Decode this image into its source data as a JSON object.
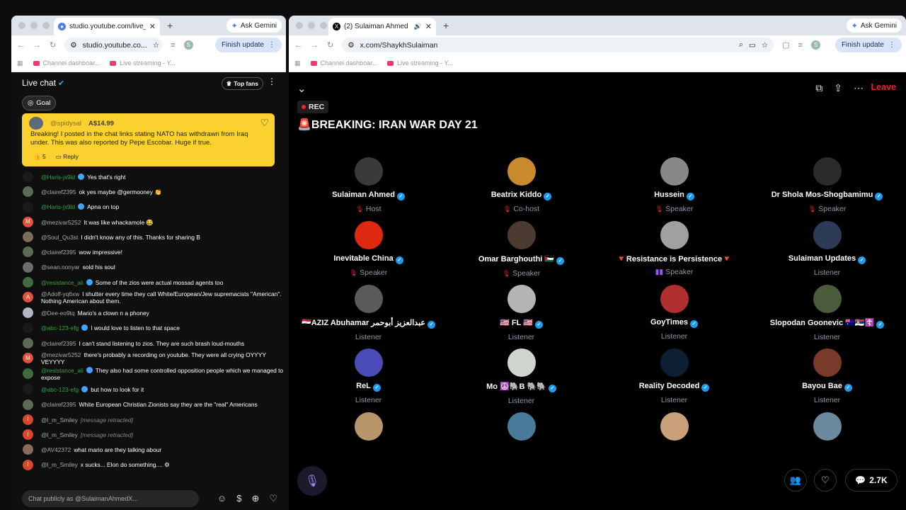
{
  "left_window": {
    "tab_title": "studio.youtube.com/live_chat",
    "url": "studio.youtube.co...",
    "ask_gemini": "Ask Gemini",
    "finish_update": "Finish update",
    "profile_initial": "S",
    "bookmarks": [
      "Channel dashboar...",
      "Live streaming - Y..."
    ]
  },
  "chat": {
    "title": "Live chat",
    "top_fans": "Top fans",
    "goal": "Goal",
    "superchat": {
      "user": "@spidysal",
      "amount": "A$14.99",
      "message": "Breaking! I posted in the chat links stating NATO has withdrawn from Iraq under. This was also reported by Pepe Escobar. Huge if true.",
      "likes": "5",
      "reply": "Reply"
    },
    "messages": [
      {
        "user": "@Haris-jx9ld",
        "text": "Yes that's right",
        "mod": true,
        "av": "#1a1a1a",
        "letter": ""
      },
      {
        "user": "@clairef2395",
        "text": "ok yes maybe @germooney 👏",
        "mod": false,
        "av": "#5b6b55",
        "letter": ""
      },
      {
        "user": "@Haris-jx9ld",
        "text": "Apna on top",
        "mod": true,
        "av": "#1a1a1a",
        "letter": ""
      },
      {
        "user": "@mezivar5252",
        "text": "It was like whackamole 😂",
        "mod": false,
        "av": "#e0533a",
        "letter": "M"
      },
      {
        "user": "@Soul_Qu3st",
        "text": "I didn't know any of this. Thanks for sharing B",
        "mod": false,
        "av": "#7a6e5a",
        "letter": ""
      },
      {
        "user": "@clairef2395",
        "text": "wow impressive!",
        "mod": false,
        "av": "#5b6b55",
        "letter": ""
      },
      {
        "user": "@sean.nonyar",
        "text": "sold his soul",
        "mod": false,
        "av": "#6d6d6d",
        "letter": ""
      },
      {
        "user": "@resistance_ali",
        "text": "Some of the zios were actual mossad agents too",
        "mod": true,
        "av": "#3f6b3f",
        "letter": ""
      },
      {
        "user": "@Adolf-yq6xw",
        "text": "I shutter every time they call White/European/Jew supremacists \"American\". Nothing American about them.",
        "mod": false,
        "av": "#e0533a",
        "letter": "A"
      },
      {
        "user": "@Dee-eo9tq",
        "text": "Mario's a clown n a phoney",
        "mod": false,
        "av": "#b0b8c4",
        "letter": ""
      },
      {
        "user": "@abc-123-efg",
        "text": "I would love to listen to that space",
        "mod": true,
        "av": "#1a1a1a",
        "letter": ""
      },
      {
        "user": "@clairef2395",
        "text": "I can't stand listening to zios. They are such brash loud-mouths",
        "mod": false,
        "av": "#5b6b55",
        "letter": ""
      },
      {
        "user": "@mezivar5252",
        "text": "there's probably a recording on youtube. They were all crying OYYYY VEYYYY",
        "mod": false,
        "av": "#e0533a",
        "letter": "M"
      },
      {
        "user": "@resistance_ali",
        "text": "They also had some controlled opposition people which we managed to expose",
        "mod": true,
        "av": "#3f6b3f",
        "letter": ""
      },
      {
        "user": "@abc-123-efg",
        "text": "but how to look for it",
        "mod": true,
        "av": "#1a1a1a",
        "letter": ""
      },
      {
        "user": "@clairef2395",
        "text": "White European Christian Zionists say they are the \"real\" Americans",
        "mod": false,
        "av": "#5b6b55",
        "letter": ""
      },
      {
        "user": "@l_m_Smiley",
        "text": "[message retracted]",
        "mod": false,
        "av": "#d9472b",
        "letter": "I",
        "retracted": true
      },
      {
        "user": "@l_m_Smiley",
        "text": "[message retracted]",
        "mod": false,
        "av": "#d9472b",
        "letter": "I",
        "retracted": true
      },
      {
        "user": "@AV42372",
        "text": "what mario are they talking abour",
        "mod": false,
        "av": "#8a6a5a",
        "letter": ""
      },
      {
        "user": "@l_m_Smiley",
        "text": "x sucks... Elon do something.... ⚙",
        "mod": false,
        "av": "#d9472b",
        "letter": "I"
      }
    ],
    "input_placeholder": "Chat publicly as @SulaimanAhmedX..."
  },
  "right_window": {
    "tab_title": "(2) Sulaiman Ahmed (@Sh",
    "url": "x.com/ShaykhSulaiman",
    "ask_gemini": "Ask Gemini",
    "finish_update": "Finish update",
    "profile_initial": "S",
    "bookmarks": [
      "Channel dashboar...",
      "Live streaming - Y..."
    ]
  },
  "space": {
    "rec": "REC",
    "title": "🚨BREAKING: IRAN WAR DAY 21",
    "leave": "Leave",
    "participants": [
      {
        "name": "Sulaiman Ahmed",
        "role": "Host",
        "icon": "red",
        "verified": true,
        "av": "#3a3a3a"
      },
      {
        "name": "Beatrix Kiddo",
        "role": "Co-host",
        "icon": "red",
        "verified": true,
        "av": "#c98a2e"
      },
      {
        "name": "Hussein",
        "role": "Speaker",
        "icon": "red",
        "verified": true,
        "av": "#888888"
      },
      {
        "name": "Dr Shola Mos-Shogbamimu",
        "role": "Speaker",
        "icon": "red",
        "verified": true,
        "av": "#2b2b2b"
      },
      {
        "name": "Inevitable China",
        "role": "Speaker",
        "icon": "red",
        "verified": true,
        "av": "#de2910"
      },
      {
        "name": "Omar Barghouthi 🇵🇸",
        "role": "Speaker",
        "icon": "red",
        "verified": true,
        "av": "#4a3a30"
      },
      {
        "name": "🔻Resistance is Persistence🔻",
        "role": "Speaker",
        "icon": "purple",
        "verified": false,
        "av": "#a0a0a0"
      },
      {
        "name": "Sulaiman Updates",
        "role": "Listener",
        "icon": "",
        "verified": true,
        "av": "#2d3a55"
      },
      {
        "name": "🇪🇬AZIZ Abuhamar عبدالعزيز أبوحمر",
        "role": "Listener",
        "icon": "",
        "verified": true,
        "av": "#5a5a5a"
      },
      {
        "name": "🇺🇸 FL 🇺🇸",
        "role": "Listener",
        "icon": "",
        "verified": true,
        "av": "#b5b5b5"
      },
      {
        "name": "GoyTimes",
        "role": "Listener",
        "icon": "",
        "verified": true,
        "av": "#b03030"
      },
      {
        "name": "Slopodan Goonevic 🇦🇺🇷🇸☦️",
        "role": "Listener",
        "icon": "",
        "verified": true,
        "av": "#4a5a3a"
      },
      {
        "name": "ReL",
        "role": "Listener",
        "icon": "",
        "verified": true,
        "av": "#4b4bb8"
      },
      {
        "name": "Mo ☮️🐘B 🐘🐘",
        "role": "Listener",
        "icon": "",
        "verified": true,
        "av": "#cfd4cf"
      },
      {
        "name": "Reality Decoded",
        "role": "Listener",
        "icon": "",
        "verified": true,
        "av": "#0f1f33"
      },
      {
        "name": "Bayou Bae",
        "role": "Listener",
        "icon": "",
        "verified": true,
        "av": "#7a3a2a"
      },
      {
        "name": "",
        "role": "",
        "icon": "",
        "verified": false,
        "av": "#b8956a"
      },
      {
        "name": "",
        "role": "",
        "icon": "",
        "verified": false,
        "av": "#4a7a99"
      },
      {
        "name": "",
        "role": "",
        "icon": "",
        "verified": false,
        "av": "#c9a07a"
      },
      {
        "name": "",
        "role": "",
        "icon": "",
        "verified": false,
        "av": "#6b8aa0"
      }
    ],
    "listener_count": "2.7K"
  }
}
